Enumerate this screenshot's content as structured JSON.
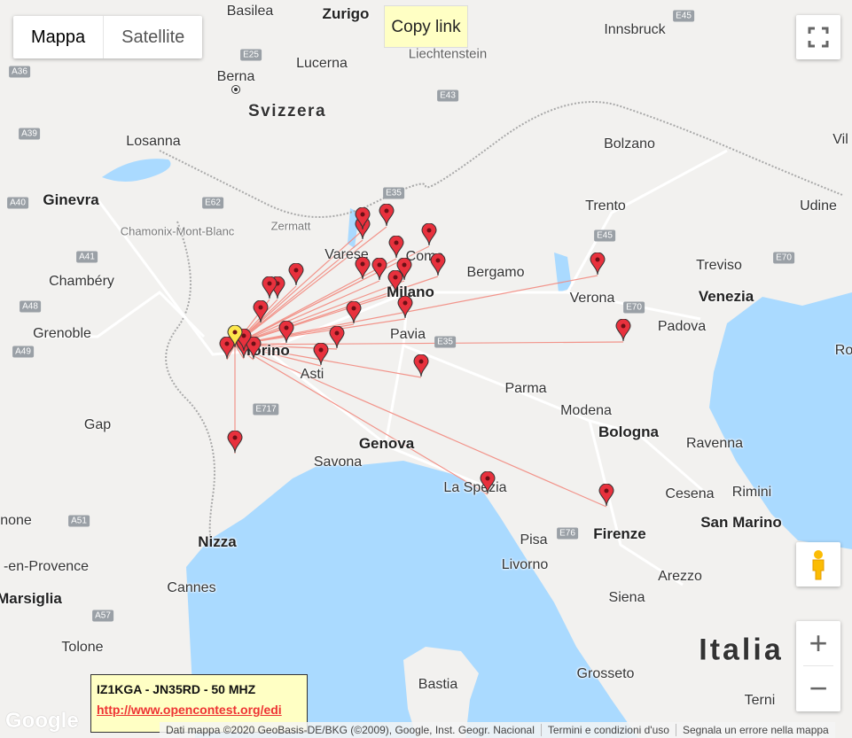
{
  "map_type": {
    "map_label": "Mappa",
    "satellite_label": "Satellite",
    "selected": "Mappa"
  },
  "copy_link_label": "Copy link",
  "colors": {
    "marker": "#e8313d",
    "home_marker": "#fde74c",
    "path": "#f28a80",
    "sea": "#aadaff",
    "land": "#f2f1ef",
    "info_bg": "#ffffc4"
  },
  "places": [
    {
      "id": "basilea",
      "name": "Basilea",
      "type": "city"
    },
    {
      "id": "zurigo",
      "name": "Zurigo",
      "type": "major"
    },
    {
      "id": "liechtenstein",
      "name": "Liechtenstein",
      "type": "region"
    },
    {
      "id": "innsbruck",
      "name": "Innsbruck",
      "type": "city"
    },
    {
      "id": "berna",
      "name": "Berna",
      "type": "capital"
    },
    {
      "id": "lucerna",
      "name": "Lucerna",
      "type": "city"
    },
    {
      "id": "svizzera",
      "name": "Svizzera",
      "type": "country"
    },
    {
      "id": "losanna",
      "name": "Losanna",
      "type": "city"
    },
    {
      "id": "bolzano",
      "name": "Bolzano",
      "type": "city"
    },
    {
      "id": "vil",
      "name": "Vil",
      "type": "city"
    },
    {
      "id": "ginevra",
      "name": "Ginevra",
      "type": "major"
    },
    {
      "id": "chamonix",
      "name": "Chamonix-Mont-Blanc",
      "type": "small"
    },
    {
      "id": "zermatt",
      "name": "Zermatt",
      "type": "small"
    },
    {
      "id": "trento",
      "name": "Trento",
      "type": "city"
    },
    {
      "id": "udine",
      "name": "Udine",
      "type": "city"
    },
    {
      "id": "varese",
      "name": "Varese",
      "type": "city"
    },
    {
      "id": "como",
      "name": "Como",
      "type": "city"
    },
    {
      "id": "bergamo",
      "name": "Bergamo",
      "type": "city"
    },
    {
      "id": "treviso",
      "name": "Treviso",
      "type": "city"
    },
    {
      "id": "chambery",
      "name": "Chambéry",
      "type": "city"
    },
    {
      "id": "milano",
      "name": "Milano",
      "type": "major"
    },
    {
      "id": "verona",
      "name": "Verona",
      "type": "city"
    },
    {
      "id": "venezia",
      "name": "Venezia",
      "type": "major"
    },
    {
      "id": "grenoble",
      "name": "Grenoble",
      "type": "city"
    },
    {
      "id": "pavia",
      "name": "Pavia",
      "type": "city"
    },
    {
      "id": "padova",
      "name": "Padova",
      "type": "city"
    },
    {
      "id": "torino",
      "name": "Torino",
      "type": "major"
    },
    {
      "id": "asti",
      "name": "Asti",
      "type": "city"
    },
    {
      "id": "parma",
      "name": "Parma",
      "type": "city"
    },
    {
      "id": "modena",
      "name": "Modena",
      "type": "city"
    },
    {
      "id": "gap",
      "name": "Gap",
      "type": "city"
    },
    {
      "id": "bologna",
      "name": "Bologna",
      "type": "major"
    },
    {
      "id": "ravenna",
      "name": "Ravenna",
      "type": "city"
    },
    {
      "id": "genova",
      "name": "Genova",
      "type": "major"
    },
    {
      "id": "savona",
      "name": "Savona",
      "type": "city"
    },
    {
      "id": "laspezia",
      "name": "La Spezia",
      "type": "city"
    },
    {
      "id": "cesena",
      "name": "Cesena",
      "type": "city"
    },
    {
      "id": "rimini",
      "name": "Rimini",
      "type": "city"
    },
    {
      "id": "sanmarino",
      "name": "San Marino",
      "type": "major"
    },
    {
      "id": "anone",
      "name": "none",
      "type": "city"
    },
    {
      "id": "nizza",
      "name": "Nizza",
      "type": "major"
    },
    {
      "id": "pisa",
      "name": "Pisa",
      "type": "city"
    },
    {
      "id": "firenze",
      "name": "Firenze",
      "type": "major"
    },
    {
      "id": "provence",
      "name": "-en-Provence",
      "type": "city"
    },
    {
      "id": "livorno",
      "name": "Livorno",
      "type": "city"
    },
    {
      "id": "cannes",
      "name": "Cannes",
      "type": "city"
    },
    {
      "id": "arezzo",
      "name": "Arezzo",
      "type": "city"
    },
    {
      "id": "marsiglia",
      "name": "Marsiglia",
      "type": "major"
    },
    {
      "id": "siena",
      "name": "Siena",
      "type": "city"
    },
    {
      "id": "italia",
      "name": "Italia",
      "type": "big"
    },
    {
      "id": "tolone",
      "name": "Tolone",
      "type": "city"
    },
    {
      "id": "bastia",
      "name": "Bastia",
      "type": "city"
    },
    {
      "id": "grosseto",
      "name": "Grosseto",
      "type": "city"
    },
    {
      "id": "terni",
      "name": "Terni",
      "type": "city"
    },
    {
      "id": "ro",
      "name": "Ro",
      "type": "city"
    }
  ],
  "roads": [
    "E45",
    "E25",
    "A36",
    "E43",
    "A39",
    "E35",
    "A40",
    "E62",
    "E45",
    "E70",
    "A41",
    "A48",
    "A49",
    "E70",
    "E35",
    "E717",
    "E76",
    "A51",
    "A57"
  ],
  "info_box": {
    "title": "IZ1KGA - JN35RD - 50 MHZ",
    "link": "http://www.opencontest.org/edi"
  },
  "google_logo": "Google",
  "attribution": {
    "data": "Dati mappa ©2020 GeoBasis-DE/BKG (©2009), Google, Inst. Geogr. Nacional",
    "terms": "Termini e condizioni d'uso",
    "report": "Segnala un errore nella mappa"
  },
  "controls": {
    "zoom_in": "+",
    "zoom_out": "−"
  }
}
